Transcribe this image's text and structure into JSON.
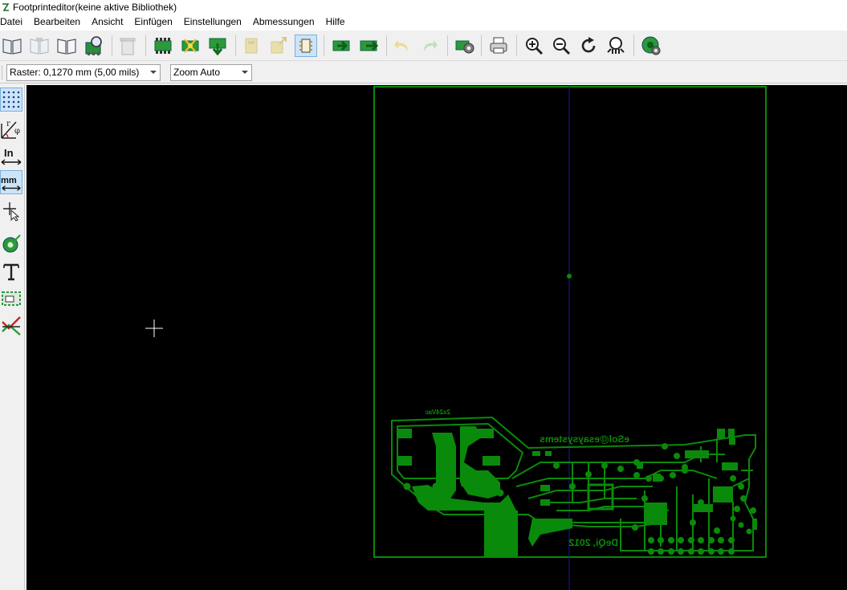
{
  "window": {
    "title": "Footprinteditor(keine aktive Bibliothek)"
  },
  "menu": {
    "items": [
      "Datei",
      "Bearbeiten",
      "Ansicht",
      "Einfügen",
      "Einstellungen",
      "Abmessungen",
      "Hilfe"
    ]
  },
  "toolbar": {
    "icons": [
      "library-icon",
      "library-dim-icon",
      "library-open-icon",
      "library-browse-icon",
      "trash-icon",
      "new-footprint-icon",
      "wizard-icon",
      "load-footprint-icon",
      "save-footprint-icon",
      "export-footprint-icon",
      "footprint-properties-icon",
      "load-from-board-icon",
      "insert-into-board-icon",
      "undo-icon",
      "redo-icon",
      "settings-icon",
      "print-icon",
      "zoom-in-icon",
      "zoom-out-icon",
      "redraw-icon",
      "zoom-fit-icon",
      "3d-viewer-icon"
    ]
  },
  "options": {
    "grid_value": "Raster: 0,1270 mm (5,00 mils)",
    "zoom_value": "Zoom Auto"
  },
  "left_toolbar": {
    "unit_inch": "In",
    "unit_mm": "mm",
    "polar_r": "r",
    "polar_phi": "φ"
  },
  "pcb": {
    "text_top_left": "2x24Vac",
    "text_email": "eSol@esaysystems",
    "text_copyright": "DeQi, 2012",
    "text_plus": "+",
    "text_minus": "-",
    "trace_color": "#008a00",
    "background_color": "#000000",
    "cursor_color": "#ffffff",
    "axis_color": "#1a1aa6"
  },
  "colors": {
    "active_tool_bg": "#cce4f7",
    "toolbar_bg": "#f0f0f0"
  }
}
